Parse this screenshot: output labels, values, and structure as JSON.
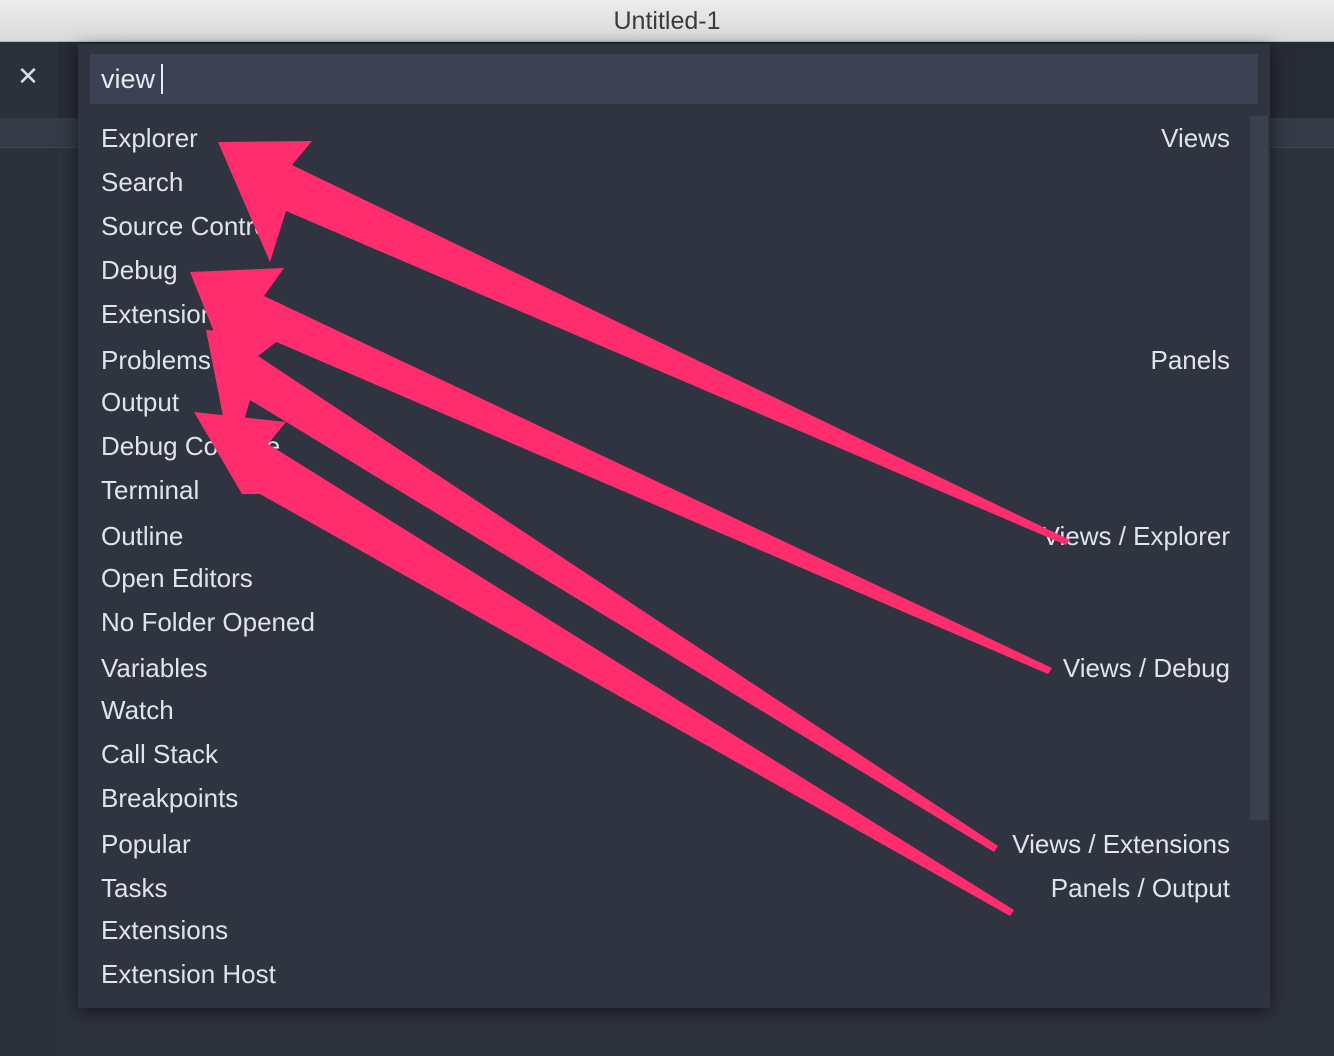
{
  "window": {
    "title": "Untitled-1"
  },
  "search": {
    "value": "view"
  },
  "items": [
    {
      "label": "Explorer",
      "group": "Views"
    },
    {
      "label": "Search",
      "group": ""
    },
    {
      "label": "Source Control",
      "group": ""
    },
    {
      "label": "Debug",
      "group": ""
    },
    {
      "label": "Extensions",
      "group": ""
    },
    {
      "label": "Problems",
      "group": "Panels"
    },
    {
      "label": "Output",
      "group": ""
    },
    {
      "label": "Debug Console",
      "group": ""
    },
    {
      "label": "Terminal",
      "group": ""
    },
    {
      "label": "Outline",
      "group": "Views / Explorer"
    },
    {
      "label": "Open Editors",
      "group": ""
    },
    {
      "label": "No Folder Opened",
      "group": ""
    },
    {
      "label": "Variables",
      "group": "Views / Debug"
    },
    {
      "label": "Watch",
      "group": ""
    },
    {
      "label": "Call Stack",
      "group": ""
    },
    {
      "label": "Breakpoints",
      "group": ""
    },
    {
      "label": "Popular",
      "group": "Views / Extensions"
    },
    {
      "label": "Tasks",
      "group": "Panels / Output"
    },
    {
      "label": "Extensions",
      "group": ""
    },
    {
      "label": "Extension Host",
      "group": ""
    }
  ],
  "annotation": {
    "arrow_color": "#ff2d6e",
    "arrow_icon": "callout-arrow-icon"
  }
}
